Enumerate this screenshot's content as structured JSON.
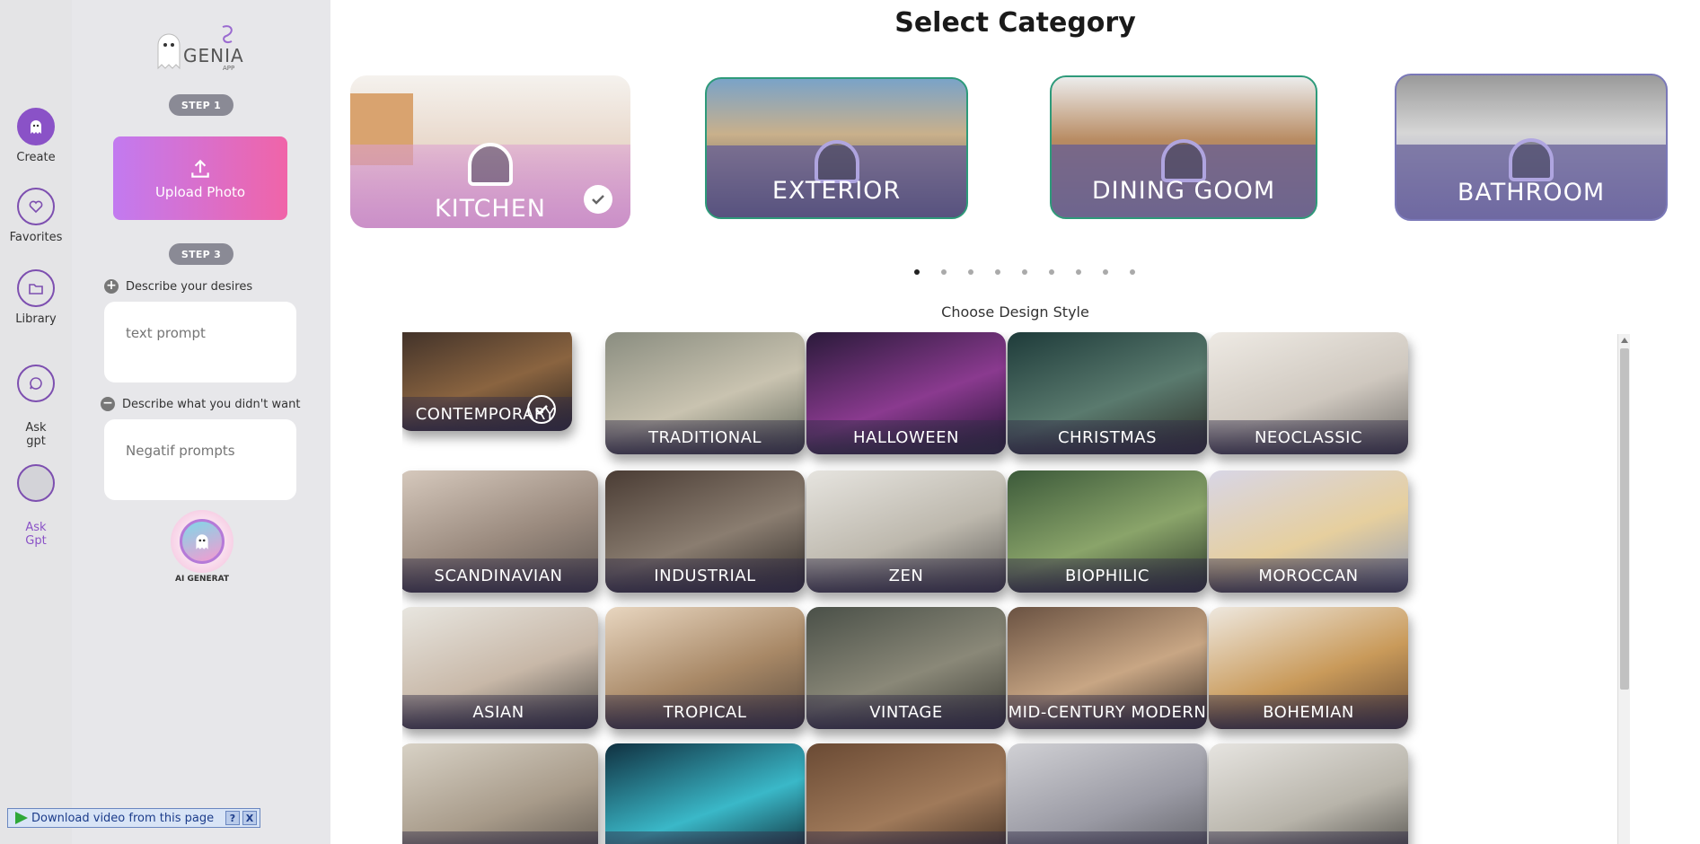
{
  "rail": {
    "items": [
      {
        "label": "Create",
        "icon": "ghost-icon"
      },
      {
        "label": "Favorites",
        "icon": "heart-icon"
      },
      {
        "label": "Library",
        "icon": "folder-icon"
      },
      {
        "label": "Ask\ngpt",
        "icon": "chat-icon"
      },
      {
        "label": "Ask\nGpt",
        "icon": "blank-icon"
      }
    ]
  },
  "panel": {
    "logo": "GENIA",
    "logo_sub": "APP",
    "step1": "STEP 1",
    "upload_label": "Upload Photo",
    "step3": "STEP 3",
    "desires_label": "Describe your desires",
    "desires_placeholder": "text prompt",
    "negative_label": "Describe what you didn't want",
    "negative_placeholder": "Negatif prompts",
    "ai_label": "AI GENERAT"
  },
  "download_bar": {
    "text": "Download video from this page",
    "help": "?",
    "close": "X"
  },
  "main": {
    "title": "Select Category",
    "subtitle": "Choose Design Style",
    "categories": [
      {
        "label": "KITCHEN",
        "selected": true
      },
      {
        "label": "EXTERIOR",
        "selected": false
      },
      {
        "label": "DINING GOOM",
        "selected": false
      },
      {
        "label": "BATHROOM",
        "selected": false
      }
    ],
    "carousel_pages": 9,
    "carousel_active": 1,
    "styles": [
      {
        "label": "CONTEMPORARY",
        "selected": true
      },
      {
        "label": "TRADITIONAL"
      },
      {
        "label": "HALLOWEEN"
      },
      {
        "label": "CHRISTMAS"
      },
      {
        "label": "NEOCLASSIC"
      },
      {
        "label": "SCANDINAVIAN"
      },
      {
        "label": "INDUSTRIAL"
      },
      {
        "label": "ZEN"
      },
      {
        "label": "BIOPHILIC"
      },
      {
        "label": "MOROCCAN"
      },
      {
        "label": "ASIAN"
      },
      {
        "label": "TROPICAL"
      },
      {
        "label": "VINTAGE"
      },
      {
        "label": "MID-CENTURY MODERN"
      },
      {
        "label": "BOHEMIAN"
      },
      {
        "label": ""
      },
      {
        "label": ""
      },
      {
        "label": ""
      },
      {
        "label": ""
      },
      {
        "label": ""
      }
    ]
  },
  "colors": {
    "accent": "#8a52c7",
    "upload_gradient_start": "#c27af0",
    "upload_gradient_end": "#f064a8",
    "category_band": "#625c96"
  }
}
